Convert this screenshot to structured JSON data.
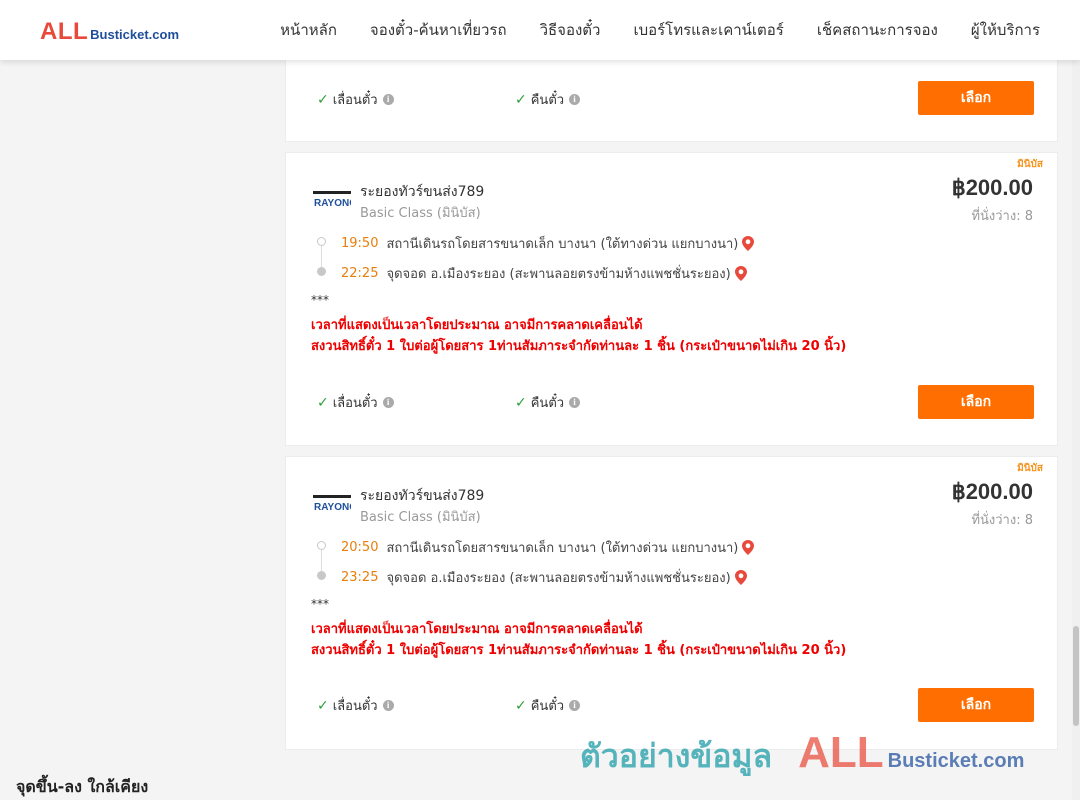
{
  "header": {
    "logo_main": "ALL",
    "logo_rest": "Busticket.com",
    "nav": [
      "หน้าหลัก",
      "จองตั๋ว-ค้นหาเที่ยวรถ",
      "วิธีจองตั๋ว",
      "เบอร์โทรและเคาน์เตอร์",
      "เช็คสถานะการจอง",
      "ผู้ให้บริการ"
    ]
  },
  "features": {
    "reschedule": "เลื่อนตั๋ว",
    "refund": "คืนตั๋ว",
    "info_glyph": "i"
  },
  "select_label": "เลือก",
  "trips": [
    {
      "badge": "มินิบัส",
      "operator": "ระยองทัวร์ขนส่ง789",
      "class": "Basic Class (มินิบัส)",
      "price": "฿200.00",
      "seats": "ที่นั่งว่าง: 8",
      "depart_time": "19:50",
      "depart_place": "สถานีเดินรถโดยสารขนาดเล็ก บางนา (ใต้ทางด่วน แยกบางนา)",
      "arrive_time": "22:25",
      "arrive_place": "จุดจอด อ.เมืองระยอง (สะพานลอยตรงข้ามห้างแพชชั่นระยอง)",
      "stars": "***",
      "note1": "เวลาที่แสดงเป็นเวลาโดยประมาณ อาจมีการคลาดเคลื่อนได้",
      "note2": "สงวนสิทธิ์ตั๋ว 1 ใบต่อผู้โดยสาร 1ท่านสัมภาระจำกัดท่านละ 1 ชิ้น (กระเป๋าขนาดไม่เกิน 20 นิ้ว)"
    },
    {
      "badge": "มินิบัส",
      "operator": "ระยองทัวร์ขนส่ง789",
      "class": "Basic Class (มินิบัส)",
      "price": "฿200.00",
      "seats": "ที่นั่งว่าง: 8",
      "depart_time": "20:50",
      "depart_place": "สถานีเดินรถโดยสารขนาดเล็ก บางนา (ใต้ทางด่วน แยกบางนา)",
      "arrive_time": "23:25",
      "arrive_place": "จุดจอด อ.เมืองระยอง (สะพานลอยตรงข้ามห้างแพชชั่นระยอง)",
      "stars": "***",
      "note1": "เวลาที่แสดงเป็นเวลาโดยประมาณ อาจมีการคลาดเคลื่อนได้",
      "note2": "สงวนสิทธิ์ตั๋ว 1 ใบต่อผู้โดยสาร 1ท่านสัมภาระจำกัดท่านละ 1 ชิ้น (กระเป๋าขนาดไม่เกิน 20 นิ้ว)"
    }
  ],
  "operator_logo_text": "RAYONG",
  "sidebar_heading": "จุดขึ้น-ลง ใกล้เคียง",
  "watermark": {
    "text": "ตัวอย่างข้อมูล",
    "logo_main": "ALL",
    "logo_rest": "Busticket.com"
  },
  "colors": {
    "accent": "#ff6e00",
    "time": "#e87e0c",
    "note": "#ee0000",
    "badge": "#f7931e",
    "check": "#2e9e3b"
  }
}
